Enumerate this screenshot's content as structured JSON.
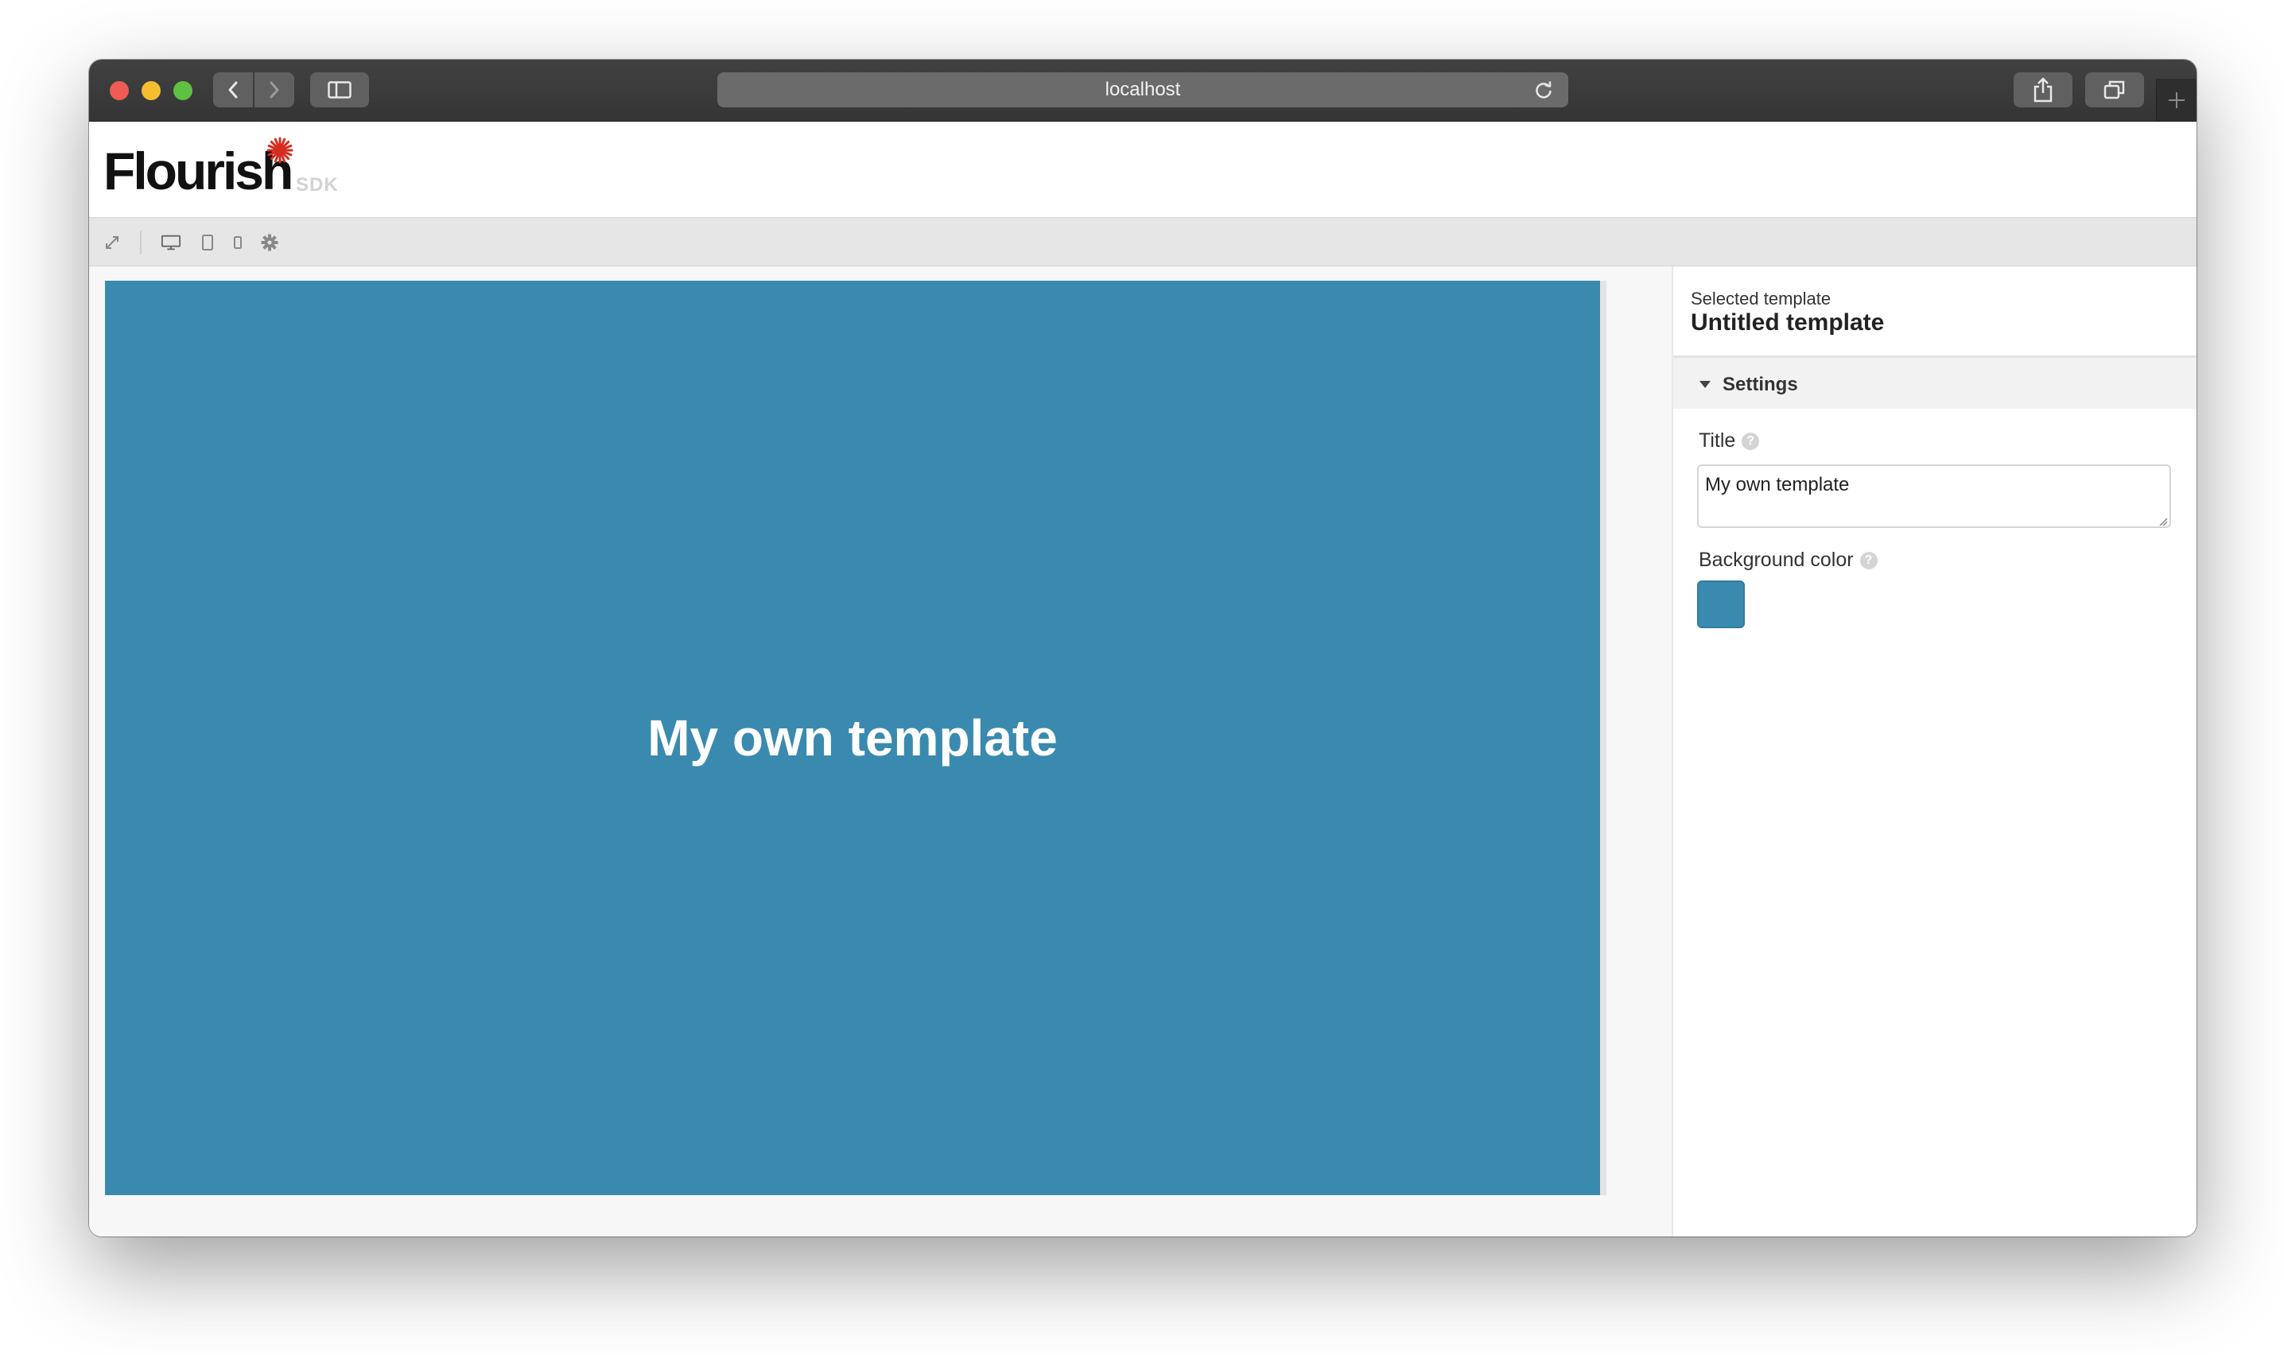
{
  "browser": {
    "url": "localhost",
    "icons": {
      "back": "chevron-left-icon",
      "forward": "chevron-right-icon",
      "sidebar": "sidebar-icon",
      "reload": "reload-icon",
      "share": "share-icon",
      "tabs": "tabs-overview-icon",
      "new_tab": "plus-icon"
    }
  },
  "header": {
    "logo": "Flourish",
    "logo_suffix": "SDK"
  },
  "preview_toolbar": {
    "icons": [
      "expand-icon",
      "desktop-icon",
      "tablet-icon",
      "mobile-icon",
      "gear-icon"
    ]
  },
  "preview": {
    "title": "My own template",
    "background_color": "#3a8ab0"
  },
  "panel": {
    "selected_label": "Selected template",
    "selected_name": "Untitled template",
    "section": "Settings",
    "fields": {
      "title_label": "Title",
      "title_value": "My own template",
      "bg_label": "Background color",
      "bg_value": "#3a8ab0"
    }
  },
  "colors": {
    "accent_star": "#d62c1f",
    "titlebar": "#3b3b3b"
  }
}
